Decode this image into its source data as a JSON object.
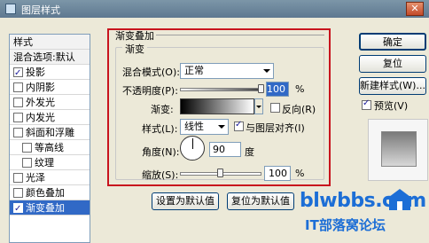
{
  "window": {
    "title": "图层样式"
  },
  "stylelist": {
    "header": "样式",
    "blend": "混合选项:默认",
    "items": [
      {
        "label": "投影",
        "checked": true
      },
      {
        "label": "内阴影",
        "checked": false
      },
      {
        "label": "外发光",
        "checked": false
      },
      {
        "label": "内发光",
        "checked": false
      },
      {
        "label": "斜面和浮雕",
        "checked": false
      },
      {
        "label": "等高线",
        "checked": false
      },
      {
        "label": "纹理",
        "checked": false
      },
      {
        "label": "光泽",
        "checked": false
      },
      {
        "label": "颜色叠加",
        "checked": false
      },
      {
        "label": "渐变叠加",
        "checked": true
      }
    ]
  },
  "panel": {
    "group_title": "渐变叠加",
    "sub_title": "渐变",
    "blend_mode_label": "混合模式(O):",
    "blend_mode_value": "正常",
    "opacity_label": "不透明度(P):",
    "opacity_value": "100",
    "opacity_unit": "%",
    "opacity_fraction": 1.0,
    "gradient_label": "渐变:",
    "reverse_label": "反向(R)",
    "style_label": "样式(L):",
    "style_value": "线性",
    "align_label": "与图层对齐(I)",
    "angle_label": "角度(N):",
    "angle_value": "90",
    "angle_unit": "度",
    "scale_label": "缩放(S):",
    "scale_value": "100",
    "scale_unit": "%",
    "scale_fraction": 0.5,
    "set_default_button": "设置为默认值",
    "reset_default_button": "复位为默认值"
  },
  "buttons": {
    "ok": "确定",
    "reset": "复位",
    "new_style": "新建样式(W)...",
    "preview_label": "预览(V)"
  },
  "watermark": {
    "line1": "blwbbs.com",
    "line2": "IT部落窝论坛"
  },
  "colors": {
    "accent": "#3169c6",
    "highlight_box": "#c8141e",
    "watermark": "#1c6ed6"
  }
}
